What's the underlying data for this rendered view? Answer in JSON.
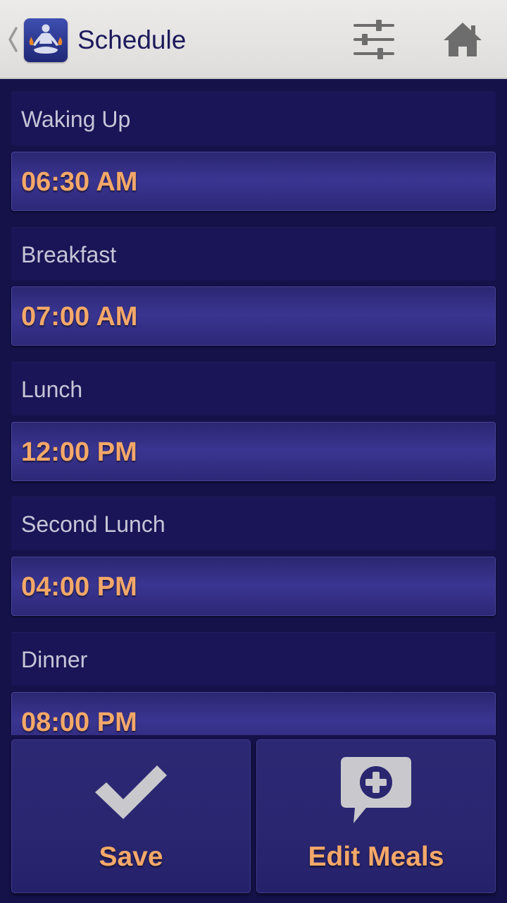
{
  "header": {
    "title": "Schedule",
    "up_icon": "chevron-left-icon",
    "logo_icon": "meditation-logo-icon",
    "actions": [
      {
        "name": "settings",
        "icon": "sliders-icon"
      },
      {
        "name": "home",
        "icon": "home-icon"
      }
    ]
  },
  "schedule": {
    "items": [
      {
        "label": "Waking Up",
        "time": "06:30 AM"
      },
      {
        "label": "Breakfast",
        "time": "07:00 AM"
      },
      {
        "label": "Lunch",
        "time": "12:00 PM"
      },
      {
        "label": "Second Lunch",
        "time": "04:00 PM"
      },
      {
        "label": "Dinner",
        "time": "08:00 PM"
      }
    ]
  },
  "footer": {
    "save_label": "Save",
    "save_icon": "checkmark-icon",
    "edit_label": "Edit Meals",
    "edit_icon": "add-comment-icon"
  },
  "colors": {
    "background": "#15124a",
    "label_bg": "#191556",
    "button_bg": "#3a3591",
    "accent_text": "#f4a869",
    "label_text": "#c7c5d8",
    "title_text": "#1d1a5c",
    "actionbar_bg": "#e6e5e3"
  }
}
